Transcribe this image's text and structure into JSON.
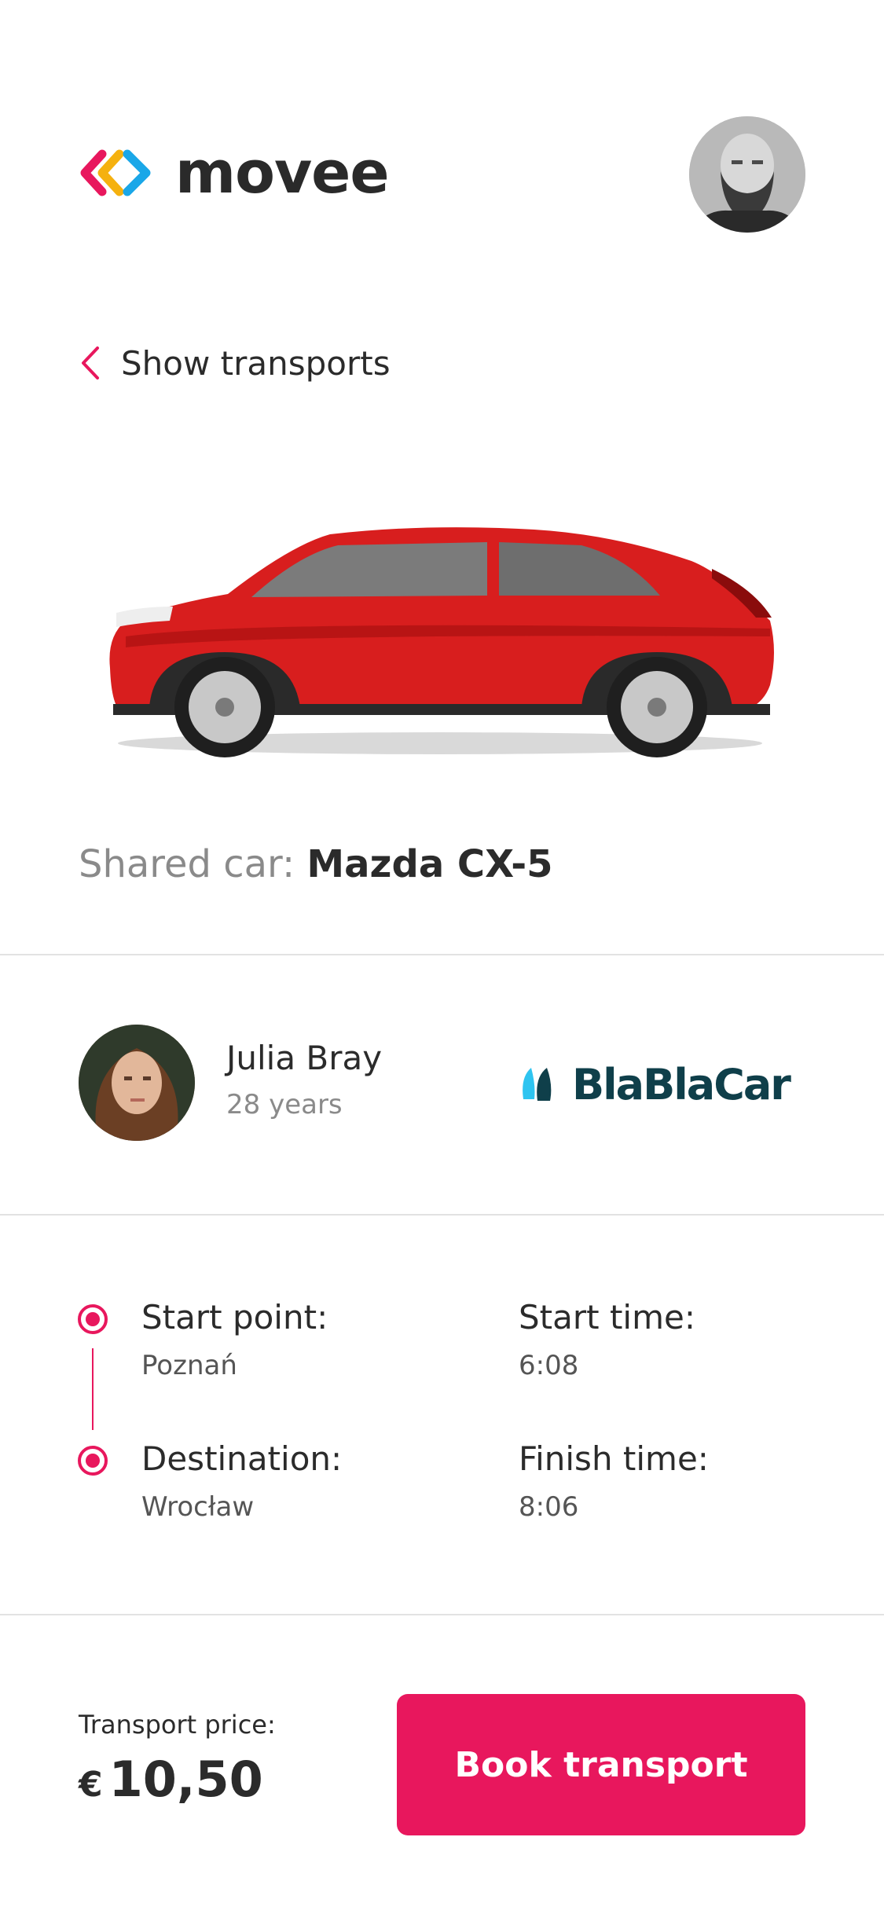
{
  "app": {
    "logo_text": "movee"
  },
  "nav": {
    "back_label": "Show transports"
  },
  "car": {
    "prefix": "Shared car: ",
    "model": "Mazda CX-5",
    "image_icon": "red-suv-photo"
  },
  "driver": {
    "name": "Julia Bray",
    "age": "28 years",
    "provider": "BlaBlaCar"
  },
  "route": {
    "start_label": "Start point:",
    "start_value": "Poznań",
    "destination_label": "Destination:",
    "destination_value": "Wrocław",
    "start_time_label": "Start time:",
    "start_time_value": "6:08",
    "finish_time_label": "Finish time:",
    "finish_time_value": "8:06"
  },
  "booking": {
    "price_label": "Transport price:",
    "currency": "€",
    "price": "10,50",
    "button_label": "Book transport"
  },
  "colors": {
    "accent": "#e8175d",
    "logo_yellow": "#f5b10f",
    "logo_blue": "#1aa7e8",
    "car_red": "#d81e1e",
    "provider_teal": "#0f3f4a"
  }
}
